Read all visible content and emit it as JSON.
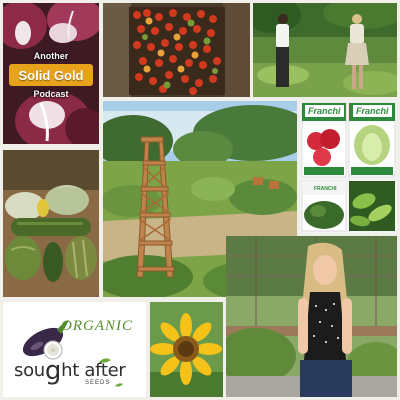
{
  "podcast": {
    "line1": "Another",
    "line2": "Solid Gold",
    "line3": "Podcast"
  },
  "packets": {
    "brand_top_left": "Franchi",
    "brand_top_right": "Franchi",
    "brand_bottom_left": "FRANCHI"
  },
  "logo": {
    "organic": "ORGANIC",
    "word_start": "sou",
    "word_g": "g",
    "word_end": "ht after",
    "seeds": "SEEDS"
  }
}
